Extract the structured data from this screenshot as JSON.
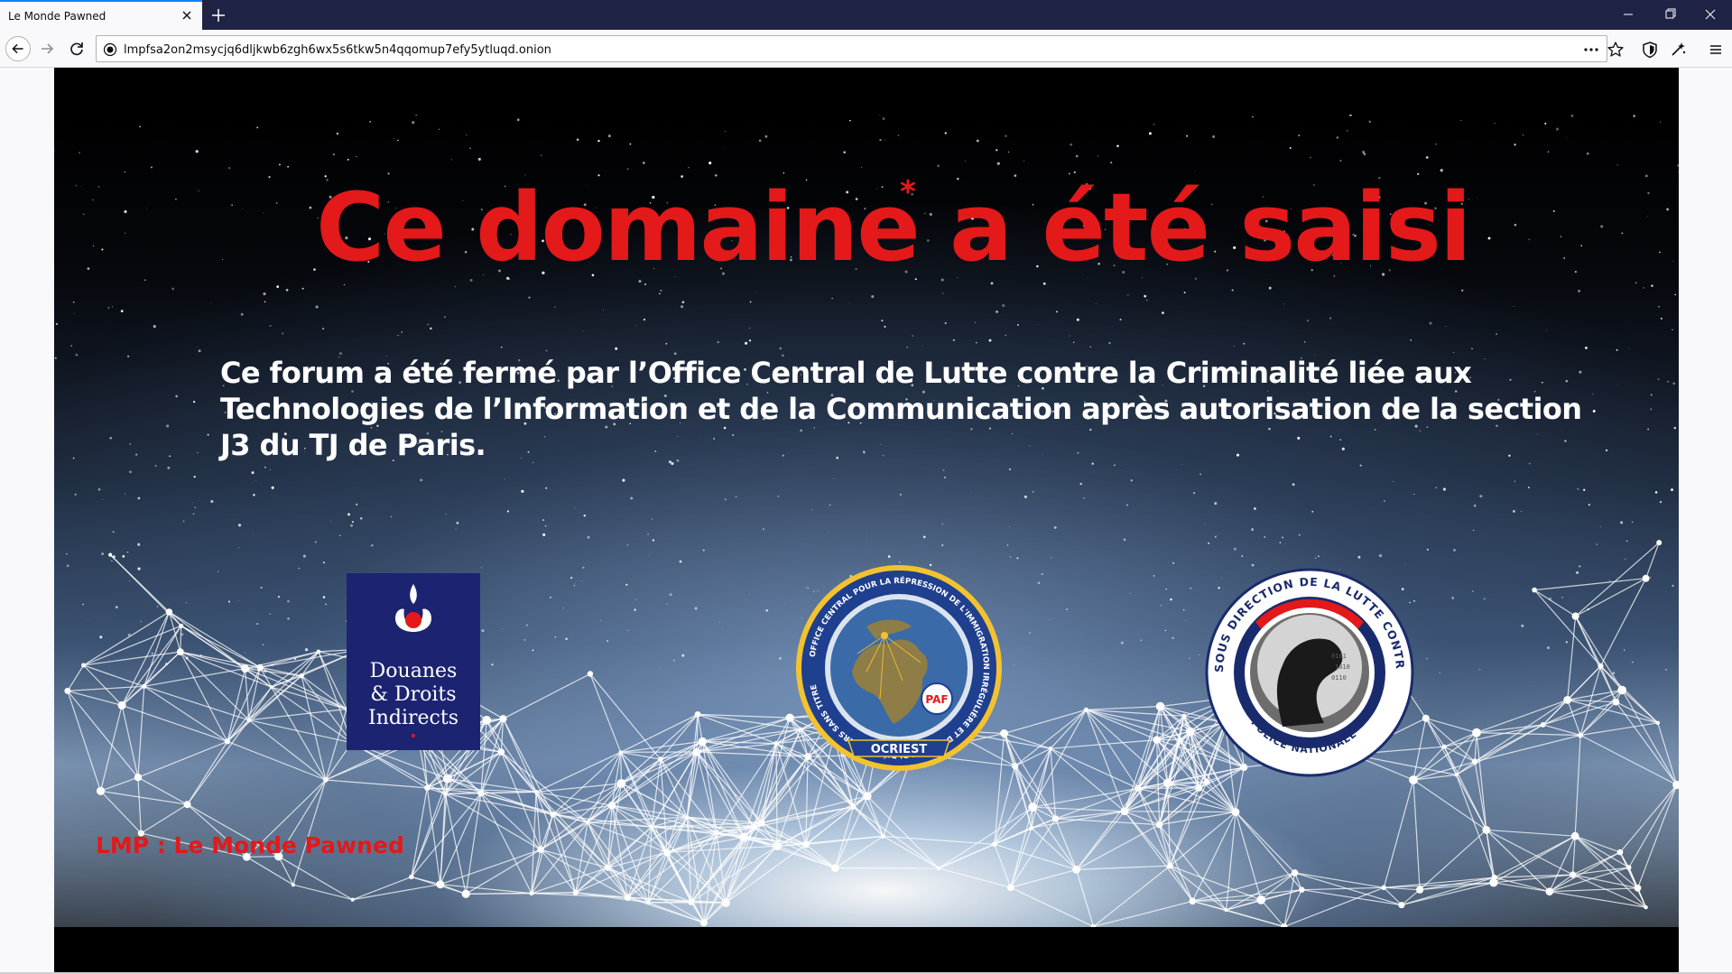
{
  "browser": {
    "tab_title": "Le Monde Pawned",
    "url": "lmpfsa2on2msycjq6dljkwb6zgh6wx5s6tkw5n4qqomup7efy5ytluqd.onion",
    "icons": [
      "tab-close-icon",
      "new-tab-icon",
      "minimize-icon",
      "restore-icon",
      "window-close-icon",
      "back-icon",
      "forward-icon",
      "reload-icon",
      "site-info-icon",
      "page-actions-icon",
      "bookmark-star-icon",
      "shield-icon",
      "extensions-icon",
      "menu-icon"
    ]
  },
  "page": {
    "headline": "Ce domaine a été saisi",
    "headline_asterisk": "*",
    "notice": "Ce forum a été fermé par l’Office Central de Lutte contre la Criminalité liée aux Technologies de l’Information et de la Communication après autorisation de la section J3 du TJ de Paris.",
    "footer_label": "LMP : Le Monde Pawned",
    "logos": {
      "douanes": [
        "Douanes",
        "& Droits",
        "Indirects"
      ],
      "ocriest": {
        "ring": "OFFICE CENTRAL POUR LA RÉPRESSION DE L'IMMIGRATION IRRÉGULIÈRE ET DE L'EMPLOI D'ÉTRANGERS SANS TITRE",
        "banner": "OCRIEST",
        "badge": "PAF"
      },
      "police": {
        "ring": "SOUS DIRECTION DE LA LUTTE CONTRE LA CYBERCRIMINALITÉ",
        "bottom": "POLICE NATIONALE"
      }
    },
    "colors": {
      "accent_red": "#e3191a",
      "douanes_blue": "#1c2471",
      "titlebar": "#1f2345"
    }
  }
}
